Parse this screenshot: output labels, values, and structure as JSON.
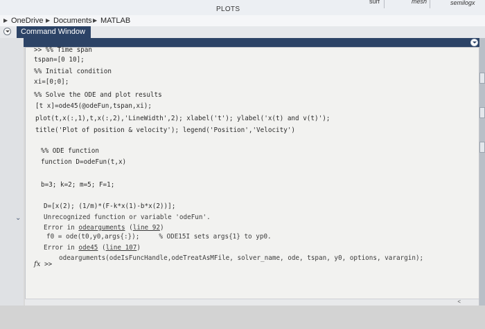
{
  "ribbon": {
    "plots_label": "PLOTS",
    "surf_label": "surf",
    "mesh_label": "mesh",
    "semilogx_label": "semilogx"
  },
  "address": {
    "items": [
      "OneDrive",
      "Documents",
      "MATLAB"
    ]
  },
  "command_window": {
    "title": "Command Window",
    "lines": [
      ">> %% Time span",
      "tspan=[0 10];",
      "%% Initial condition",
      "xi=[0;0];",
      "%% Solve the ODE and plot results",
      "[t x]=ode45(@odeFun,tspan,xi);",
      "plot(t,x(:,1),t,x(:,2),'LineWidth',2); xlabel('t'); ylabel('x(t) and v(t)');",
      "title('Plot of position & velocity'); legend('Position','Velocity')",
      "%% ODE function",
      "function D=odeFun(t,x)",
      "b=3; k=2; m=5; F=1;",
      "D=[x(2); (1/m)*(F-k*x(1)-b*x(2))];",
      "Unrecognized function or variable 'odeFun'.",
      "Error in ",
      "odearguments",
      " (",
      "line 92",
      ")",
      "f0 = ode(t0,y0,args{:});     % ODE15I sets args{1} to yp0.",
      "Error in ",
      "ode45",
      " (",
      "line 107",
      ")",
      "odearguments(odeIsFuncHandle,odeTreatAsMFile, solver_name, ode, tspan, y0, options, varargin);",
      ">>"
    ],
    "prompt_symbol": "fx"
  },
  "colors": {
    "title_bar": "#2c4366",
    "background": "#f2f2f0"
  }
}
